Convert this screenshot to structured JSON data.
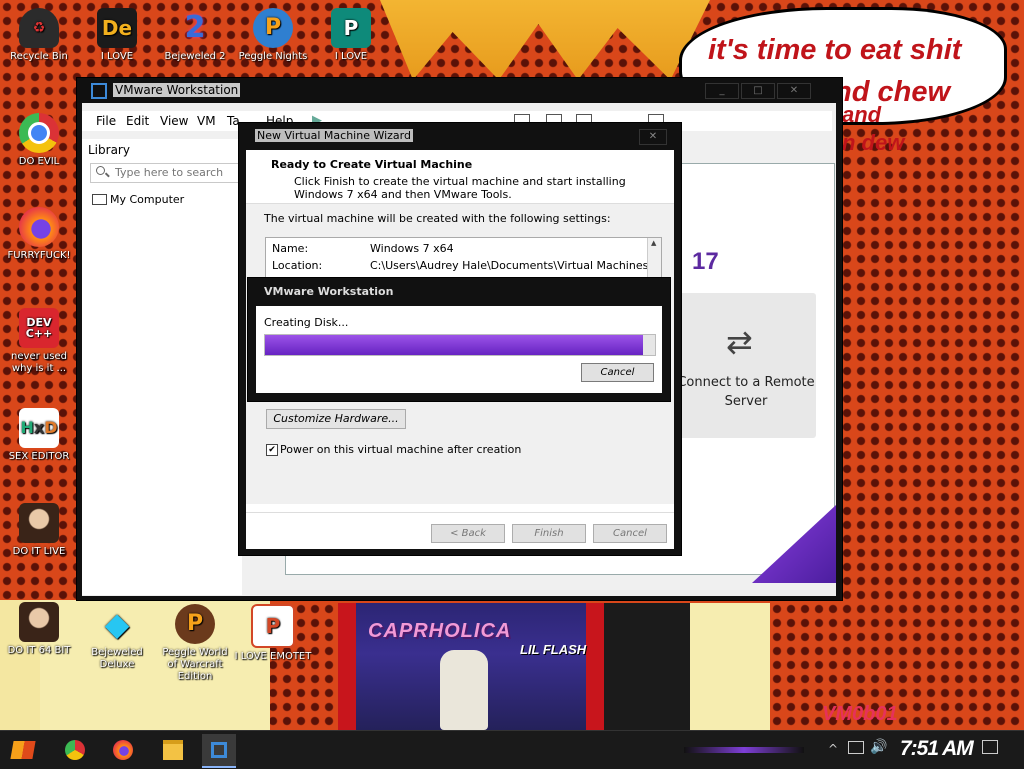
{
  "desktop": {
    "icons_col1": [
      {
        "label": "Recycle Bin",
        "icon": "recycle-bin-icon"
      },
      {
        "label": "DO EVIL",
        "icon": "chrome-icon"
      },
      {
        "label": "FURRYFUCK!",
        "icon": "firefox-icon"
      },
      {
        "label": "never used why is it ...",
        "icon": "dev-cpp-icon"
      },
      {
        "label": "SEX EDITOR",
        "icon": "hxd-icon"
      },
      {
        "label": "DO IT LIVE",
        "icon": "portrait-icon"
      },
      {
        "label": "DO IT 64 BIT",
        "icon": "portrait-64-icon"
      }
    ],
    "icons_top": [
      {
        "label": "I LOVE",
        "icon": "de-icon"
      },
      {
        "label": "Bejeweled 2",
        "icon": "bejeweled2-icon"
      },
      {
        "label": "Peggle Nights",
        "icon": "peggle-icon"
      },
      {
        "label": "I LOVE",
        "icon": "publisher-icon"
      }
    ],
    "icons_bottom": [
      {
        "label": "Bejeweled Deluxe",
        "icon": "diamond-icon"
      },
      {
        "label": "Peggle World of Warcraft Edition",
        "icon": "peggle-wow-icon"
      },
      {
        "label": "I LOVE EMOTET",
        "icon": "powerpoint-icon"
      }
    ],
    "speech_line1": "it's time to eat shit",
    "speech_line2": "nd chew",
    "speech_line3": "and",
    "speech_line4": "n dew",
    "album_title": "CAPRHOLICA",
    "album_sub": "LIL FLASH",
    "wallpaper_tag": "VM0b01"
  },
  "vmware": {
    "title": "VMware Workstation",
    "menus": [
      "File",
      "Edit",
      "View",
      "VM",
      "Ta",
      "Help"
    ],
    "library_title": "Library",
    "search_placeholder": "Type here to search",
    "library_item": "My Computer",
    "version": "17",
    "remote_label": "Connect to a Remote Server"
  },
  "wizard": {
    "title": "New Virtual Machine Wizard",
    "heading": "Ready to Create Virtual Machine",
    "subheading": "Click Finish to create the virtual machine and start installing Windows 7 x64 and then VMware Tools.",
    "intro": "The virtual machine will be created with the following settings:",
    "settings": [
      {
        "key": "Name:",
        "value": "Windows 7 x64"
      },
      {
        "key": "Location:",
        "value": "C:\\Users\\Audrey Hale\\Documents\\Virtual Machines\\..."
      }
    ],
    "customize_label": "Customize Hardware...",
    "power_on_label": "Power on this virtual machine after creation",
    "power_on_checked": true,
    "back_label": "< Back",
    "finish_label": "Finish",
    "cancel_label": "Cancel"
  },
  "progress": {
    "title": "VMware Workstation",
    "label": "Creating Disk...",
    "percent": 0.97,
    "cancel_label": "Cancel"
  },
  "taskbar": {
    "apps": [
      "start-icon",
      "chrome-icon",
      "firefox-icon",
      "file-explorer-icon",
      "vmware-icon"
    ],
    "time": "7:51 AM"
  },
  "colors": {
    "accent_purple": "#7a34d6",
    "desktop_bg": "#d9471a"
  }
}
